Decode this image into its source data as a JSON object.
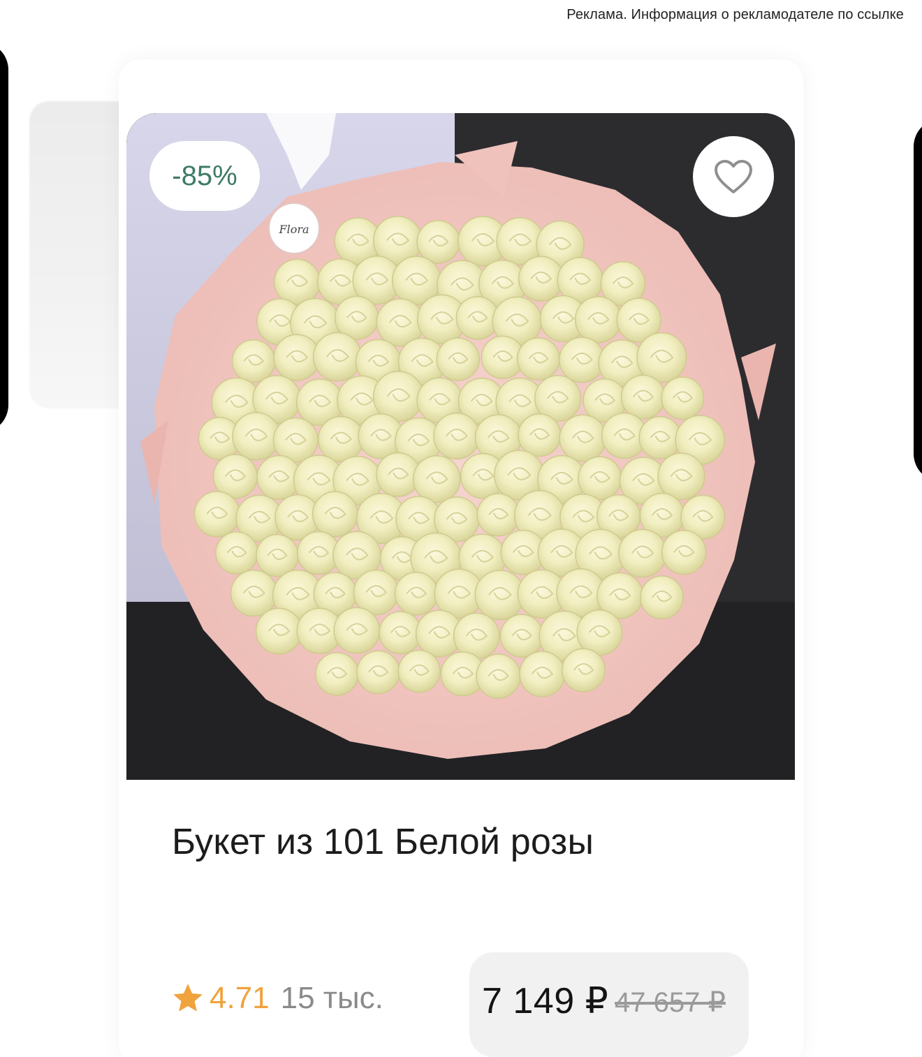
{
  "ad": {
    "disclaimer": "Реклама. Информация о рекламодателе по ссылке"
  },
  "product": {
    "title": "Букет из 101 Белой розы",
    "discount": "-85%",
    "image_alt": "Букет из 101 белой розы в розовой упаковке",
    "rating": "4.71",
    "reviews": "15 тыс.",
    "price_current": "7 149 ₽",
    "price_old": "47 657 ₽"
  },
  "icons": {
    "favorite": "heart-outline-icon",
    "rating": "star-icon"
  },
  "colors": {
    "discount_text": "#3f7a66",
    "rating_star": "#f0a23d",
    "wrap_pink": "#f3c9c4",
    "rose_cream": "#f4f1c8"
  }
}
